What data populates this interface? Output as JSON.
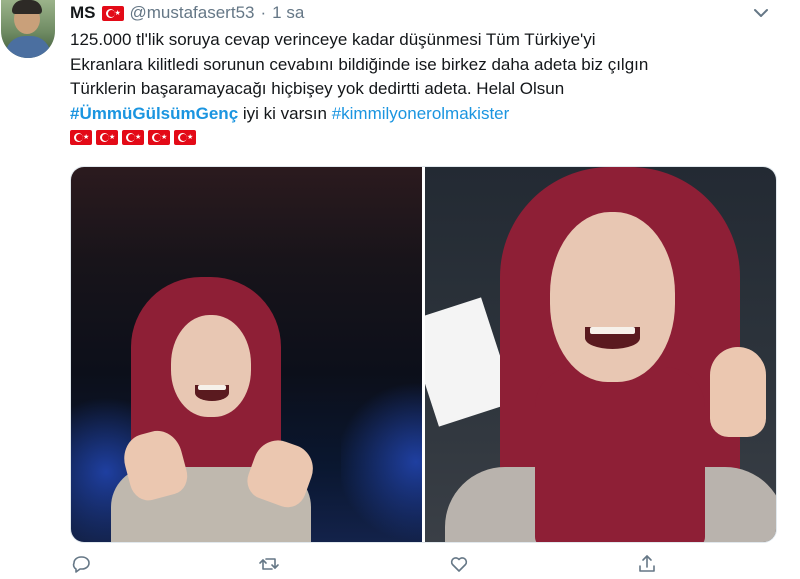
{
  "author": {
    "name": "MS",
    "handle": "@mustafasert53",
    "separator": "·",
    "time": "1 sa"
  },
  "tweet": {
    "line1": "125.000 tl'lik soruya cevap verinceye kadar düşünmesi Tüm Türkiye'yi",
    "line2": "Ekranlara kilitledi sorunun cevabını bildiğinde ise birkez daha adeta biz çılgın",
    "line3": "Türklerin başaramayacağı hiçbişey yok dedirtti adeta. Helal Olsun",
    "hashtag1": "#ÜmmüGülsümGenç",
    "middle": " iyi ki varsın ",
    "hashtag2": "#kimmilyonerolmakister"
  },
  "colors": {
    "link": "#1b95e0",
    "muted": "#657786",
    "flag": "#e30a17"
  },
  "icons": {
    "header": [
      "turkish-flag-emoji",
      "chevron-down-icon"
    ],
    "actions": [
      "reply-icon",
      "retweet-icon",
      "like-icon",
      "share-icon"
    ]
  }
}
